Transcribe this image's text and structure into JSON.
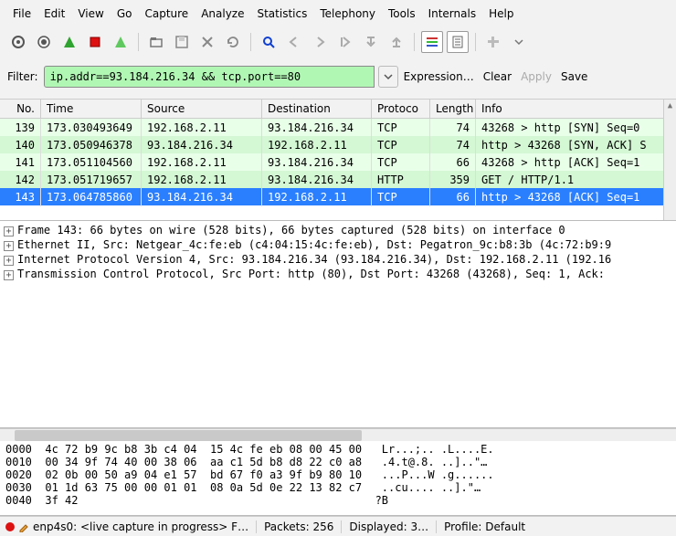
{
  "menu": [
    "File",
    "Edit",
    "View",
    "Go",
    "Capture",
    "Analyze",
    "Statistics",
    "Telephony",
    "Tools",
    "Internals",
    "Help"
  ],
  "filter": {
    "label": "Filter:",
    "value": "ip.addr==93.184.216.34 && tcp.port==80",
    "expression": "Expression…",
    "clear": "Clear",
    "apply": "Apply",
    "save": "Save"
  },
  "columns": {
    "no": "No.",
    "time": "Time",
    "src": "Source",
    "dst": "Destination",
    "proto": "Protoco",
    "len": "Length",
    "info": "Info"
  },
  "packets": [
    {
      "no": "139",
      "time": "173.030493649",
      "src": "192.168.2.11",
      "dst": "93.184.216.34",
      "proto": "TCP",
      "len": "74",
      "info": "43268 > http [SYN]  Seq=0",
      "cls": "green"
    },
    {
      "no": "140",
      "time": "173.050946378",
      "src": "93.184.216.34",
      "dst": "192.168.2.11",
      "proto": "TCP",
      "len": "74",
      "info": "http > 43268 [SYN, ACK]  S",
      "cls": "green2"
    },
    {
      "no": "141",
      "time": "173.051104560",
      "src": "192.168.2.11",
      "dst": "93.184.216.34",
      "proto": "TCP",
      "len": "66",
      "info": "43268 > http [ACK]  Seq=1",
      "cls": "green"
    },
    {
      "no": "142",
      "time": "173.051719657",
      "src": "192.168.2.11",
      "dst": "93.184.216.34",
      "proto": "HTTP",
      "len": "359",
      "info": "GET / HTTP/1.1",
      "cls": "green2"
    },
    {
      "no": "143",
      "time": "173.064785860",
      "src": "93.184.216.34",
      "dst": "192.168.2.11",
      "proto": "TCP",
      "len": "66",
      "info": "http > 43268 [ACK]  Seq=1",
      "cls": "sel"
    }
  ],
  "details": [
    "Frame 143: 66 bytes on wire (528 bits), 66 bytes captured (528 bits) on interface 0",
    "Ethernet II, Src: Netgear_4c:fe:eb (c4:04:15:4c:fe:eb), Dst: Pegatron_9c:b8:3b (4c:72:b9:9",
    "Internet Protocol Version 4, Src: 93.184.216.34 (93.184.216.34), Dst: 192.168.2.11 (192.16",
    "Transmission Control Protocol, Src Port: http (80), Dst Port: 43268 (43268), Seq: 1, Ack:"
  ],
  "hex": [
    {
      "off": "0000",
      "bytes": "4c 72 b9 9c b8 3b c4 04  15 4c fe eb 08 00 45 00",
      "ascii": "Lr...;.. .L....E."
    },
    {
      "off": "0010",
      "bytes": "00 34 9f 74 40 00 38 06  aa c1 5d b8 d8 22 c0 a8",
      "ascii": ".4.t@.8. ..]..\"…"
    },
    {
      "off": "0020",
      "bytes": "02 0b 00 50 a9 04 e1 57  bd 67 f0 a3 9f b9 80 10",
      "ascii": "...P...W .g......"
    },
    {
      "off": "0030",
      "bytes": "01 1d 63 75 00 00 01 01  08 0a 5d 0e 22 13 82 c7",
      "ascii": "..cu.... ..].\"…"
    },
    {
      "off": "0040",
      "bytes": "3f 42                                          ",
      "ascii": "?B"
    }
  ],
  "status": {
    "iface": "enp4s0: <live capture in progress> F…",
    "packets": "Packets: 256",
    "displayed": "Displayed: 3…",
    "profile": "Profile: Default"
  }
}
